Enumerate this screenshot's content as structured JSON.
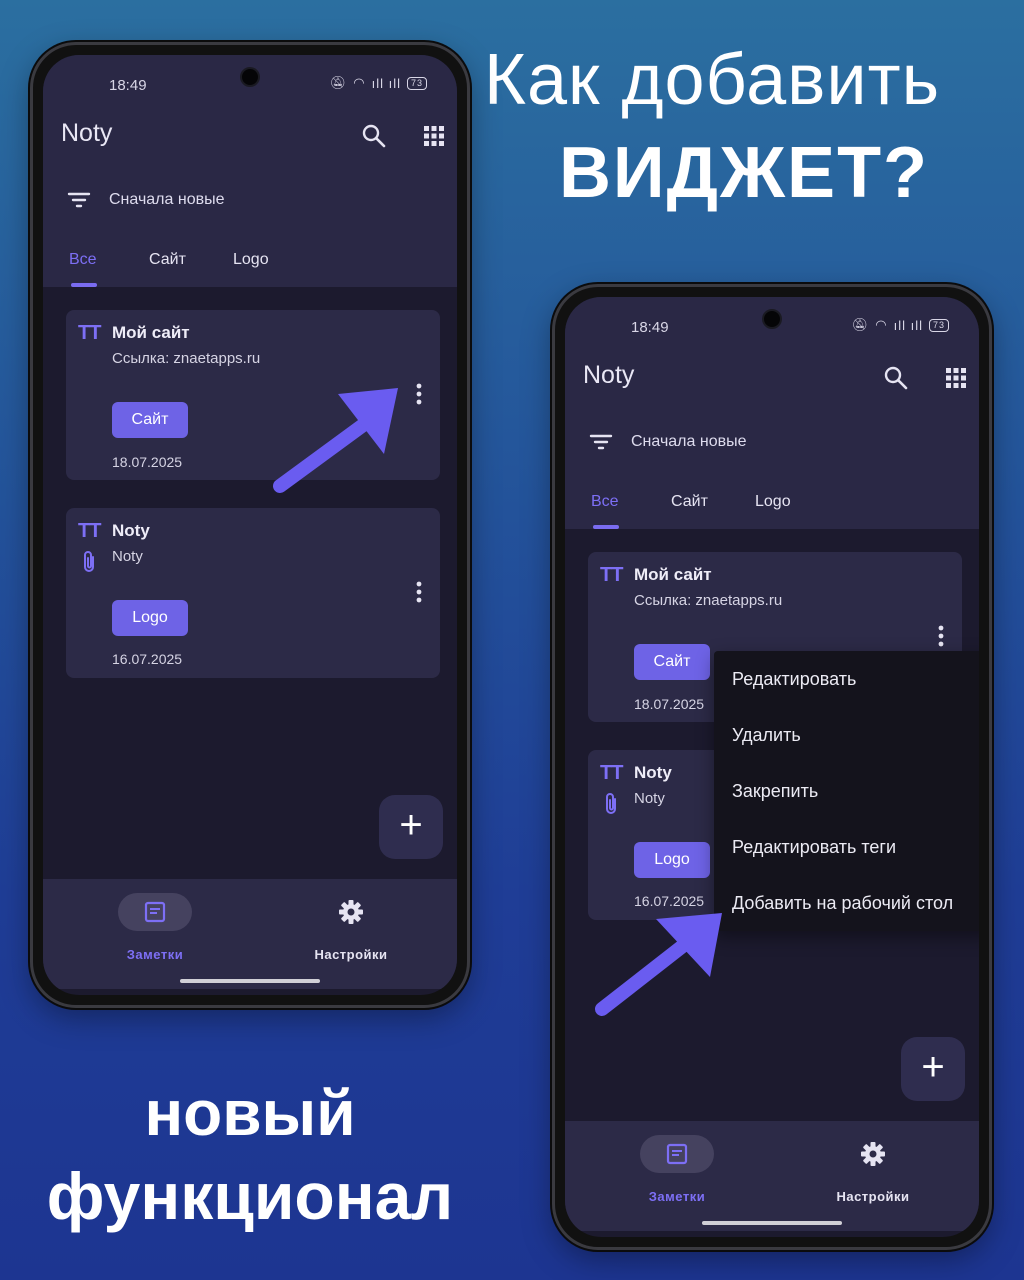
{
  "headline": {
    "line1": "Как добавить",
    "line2": "ВИДЖЕТ?"
  },
  "footline": {
    "line1": "новый",
    "line2": "функционал"
  },
  "colors": {
    "accent": "#7d6ff5",
    "button": "#6e63e6",
    "card": "#2c2a47",
    "arrow": "#6a5cf0"
  },
  "phone": {
    "status_time": "18:49",
    "battery": "73",
    "app_title": "Noty",
    "sort_label": "Сначала новые",
    "tabs": [
      "Все",
      "Сайт",
      "Logo"
    ],
    "cards": [
      {
        "title": "Мой сайт",
        "subtitle": "Ссылка: znaetapps.ru",
        "button": "Сайт",
        "date": "18.07.2025"
      },
      {
        "title": "Noty",
        "subtitle": "Noty",
        "button": "Logo",
        "date": "16.07.2025"
      }
    ],
    "fab_label": "+",
    "nav": {
      "notes": "Заметки",
      "settings": "Настройки"
    },
    "menu": [
      "Редактировать",
      "Удалить",
      "Закрепить",
      "Редактировать теги",
      "Добавить на рабочий стол"
    ]
  }
}
